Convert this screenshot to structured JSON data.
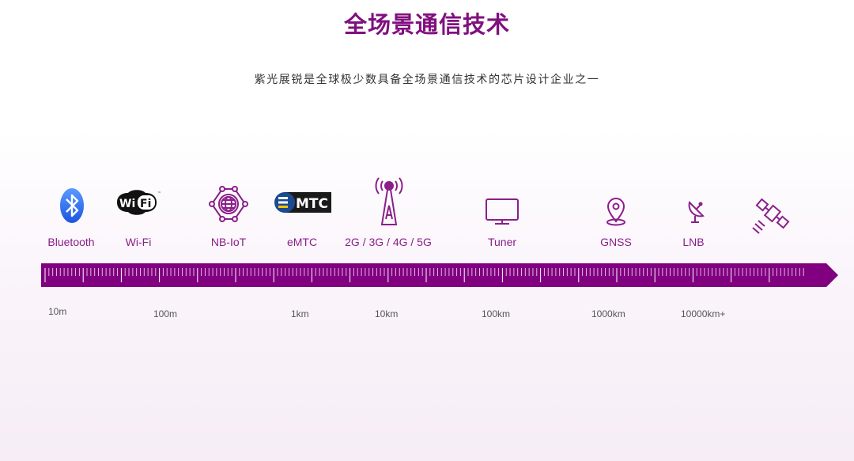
{
  "header": {
    "title": "全场景通信技术",
    "subtitle": "紫光展锐是全球极少数具备全场景通信技术的芯片设计企业之一"
  },
  "colors": {
    "brand": "#80107f",
    "label": "#8a1f8a",
    "ruler": "#800080",
    "distance_text": "#555555",
    "bluetooth_blue": "#2d6ff0"
  },
  "technologies": [
    {
      "label": "Bluetooth",
      "icon": "bluetooth-icon"
    },
    {
      "label": "Wi-Fi",
      "icon": "wifi-logo-icon"
    },
    {
      "label": "NB-IoT",
      "icon": "network-globe-icon"
    },
    {
      "label": "eMTC",
      "icon": "emtc-logo-icon"
    },
    {
      "label": "2G / 3G / 4G / 5G",
      "icon": "cell-tower-icon"
    },
    {
      "label": "Tuner",
      "icon": "monitor-icon"
    },
    {
      "label": "GNSS",
      "icon": "location-pin-icon"
    },
    {
      "label": "LNB",
      "icon": "satellite-dish-icon"
    },
    {
      "label": "",
      "icon": "satellite-icon"
    }
  ],
  "icon_text": {
    "wifi_left": "Wi",
    "wifi_right": "Fi",
    "wifi_tm": "™",
    "emtc": "MTC"
  },
  "distances": [
    "10m",
    "100m",
    "1km",
    "10km",
    "100km",
    "1000km",
    "10000km+"
  ]
}
